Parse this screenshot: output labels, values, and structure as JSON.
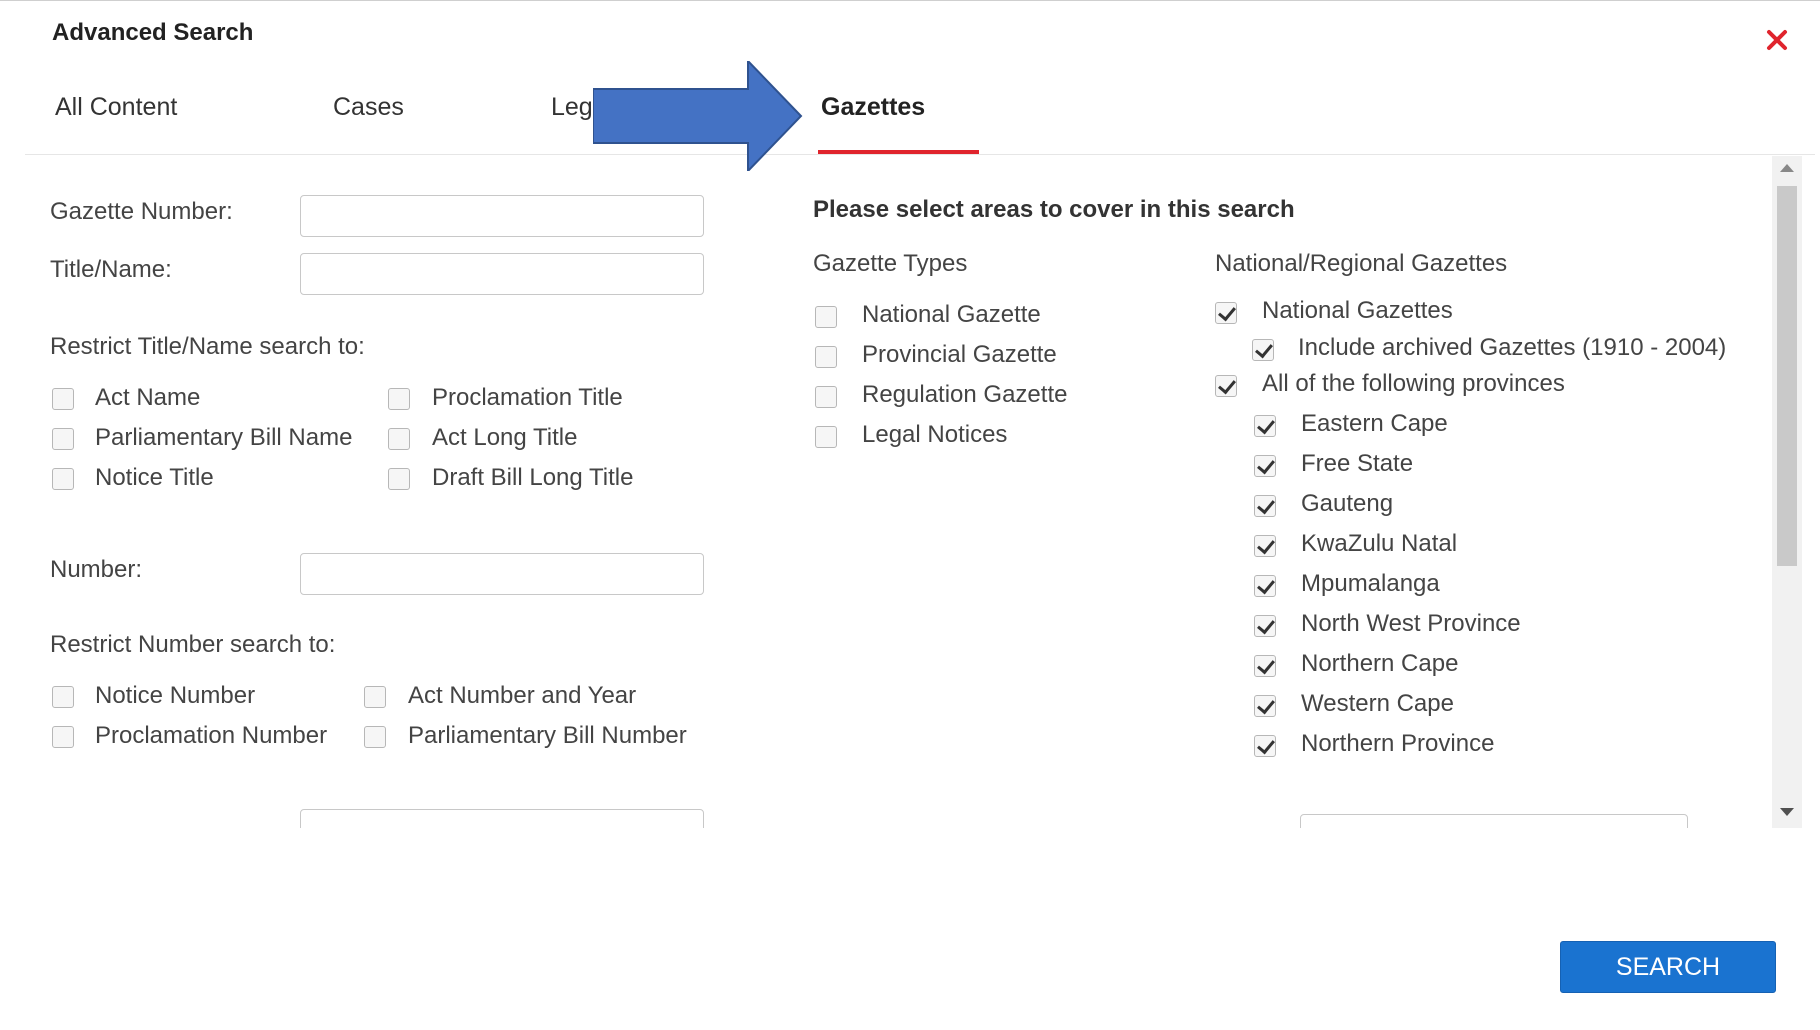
{
  "dialog": {
    "title": "Advanced Search",
    "close_icon": "close-icon",
    "close_color": "#e0242d"
  },
  "tabs": [
    {
      "label": "All Content"
    },
    {
      "label": "Cases"
    },
    {
      "label": "Legi"
    },
    {
      "label": "Gazettes",
      "active": true
    }
  ],
  "annotation": {
    "shape": "right-arrow",
    "color": "#4472c4"
  },
  "left": {
    "gazette_number_label": "Gazette Number:",
    "gazette_number_value": "",
    "title_name_label": "Title/Name:",
    "title_name_value": "",
    "restrict_title_label": "Restrict Title/Name search to:",
    "title_options": [
      {
        "label": "Act Name",
        "checked": false
      },
      {
        "label": "Proclamation Title",
        "checked": false
      },
      {
        "label": "Parliamentary Bill Name",
        "checked": false
      },
      {
        "label": "Act Long Title",
        "checked": false
      },
      {
        "label": "Notice Title",
        "checked": false
      },
      {
        "label": "Draft Bill Long Title",
        "checked": false
      }
    ],
    "number_label": "Number:",
    "number_value": "",
    "restrict_number_label": "Restrict Number search to:",
    "number_options": [
      {
        "label": "Notice Number",
        "checked": false
      },
      {
        "label": "Act Number and Year",
        "checked": false
      },
      {
        "label": "Proclamation Number",
        "checked": false
      },
      {
        "label": "Parliamentary Bill Number",
        "checked": false
      }
    ]
  },
  "right": {
    "heading": "Please select areas to cover in this search",
    "gazette_types_label": "Gazette Types",
    "gazette_types": [
      {
        "label": "National Gazette",
        "checked": false
      },
      {
        "label": "Provincial Gazette",
        "checked": false
      },
      {
        "label": "Regulation Gazette",
        "checked": false
      },
      {
        "label": "Legal Notices",
        "checked": false
      }
    ],
    "regional_label": "National/Regional Gazettes",
    "national_gazettes": {
      "label": "National Gazettes",
      "checked": true
    },
    "include_archived": {
      "label": "Include archived Gazettes (1910 - 2004)",
      "checked": true
    },
    "all_provinces": {
      "label": "All of the following provinces",
      "checked": true
    },
    "provinces": [
      {
        "label": "Eastern Cape",
        "checked": true
      },
      {
        "label": "Free State",
        "checked": true
      },
      {
        "label": "Gauteng",
        "checked": true
      },
      {
        "label": "KwaZulu Natal",
        "checked": true
      },
      {
        "label": "Mpumalanga",
        "checked": true
      },
      {
        "label": "North West Province",
        "checked": true
      },
      {
        "label": "Northern Cape",
        "checked": true
      },
      {
        "label": "Western Cape",
        "checked": true
      },
      {
        "label": "Northern Province",
        "checked": true
      }
    ]
  },
  "search_button": {
    "label": "SEARCH",
    "color": "#1a73d0"
  }
}
